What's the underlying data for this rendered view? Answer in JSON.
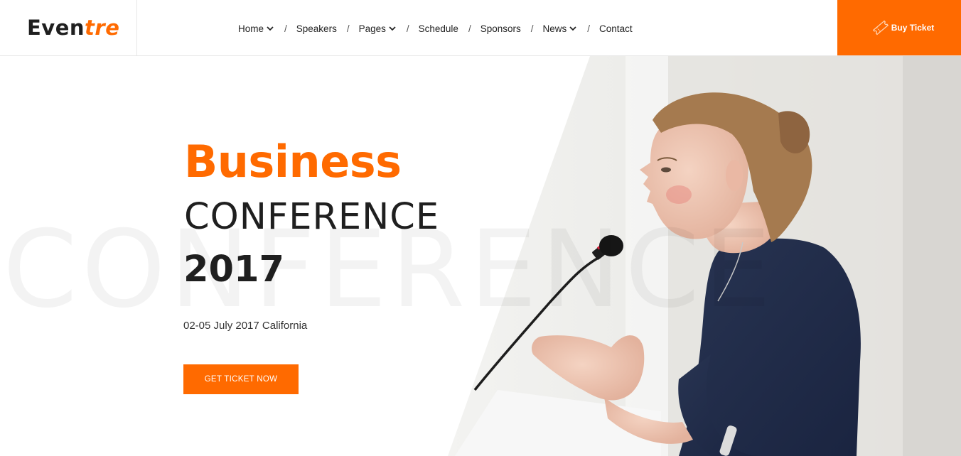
{
  "brand": {
    "logo_part1": "Even",
    "logo_part2": "tre"
  },
  "nav": {
    "items": [
      {
        "label": "Home",
        "dropdown": true
      },
      {
        "label": "Speakers",
        "dropdown": false
      },
      {
        "label": "Pages",
        "dropdown": true
      },
      {
        "label": "Schedule",
        "dropdown": false
      },
      {
        "label": "Sponsors",
        "dropdown": false
      },
      {
        "label": "News",
        "dropdown": true
      },
      {
        "label": "Contact",
        "dropdown": false
      }
    ],
    "separator": "/"
  },
  "header": {
    "buy_ticket_label": "Buy Ticket"
  },
  "hero": {
    "title_line1": "Business",
    "title_line2": "CONFERENCE",
    "title_line3": "2017",
    "watermark": "CONFERENCE",
    "date_location": "02-05 July 2017 California",
    "cta_label": "GET TICKET NOW"
  },
  "colors": {
    "accent": "#ff6a00",
    "text": "#1f1f1f",
    "background": "#ffffff"
  },
  "icons": {
    "buy_ticket": "ticket-icon",
    "dropdown": "chevron-down-icon"
  }
}
